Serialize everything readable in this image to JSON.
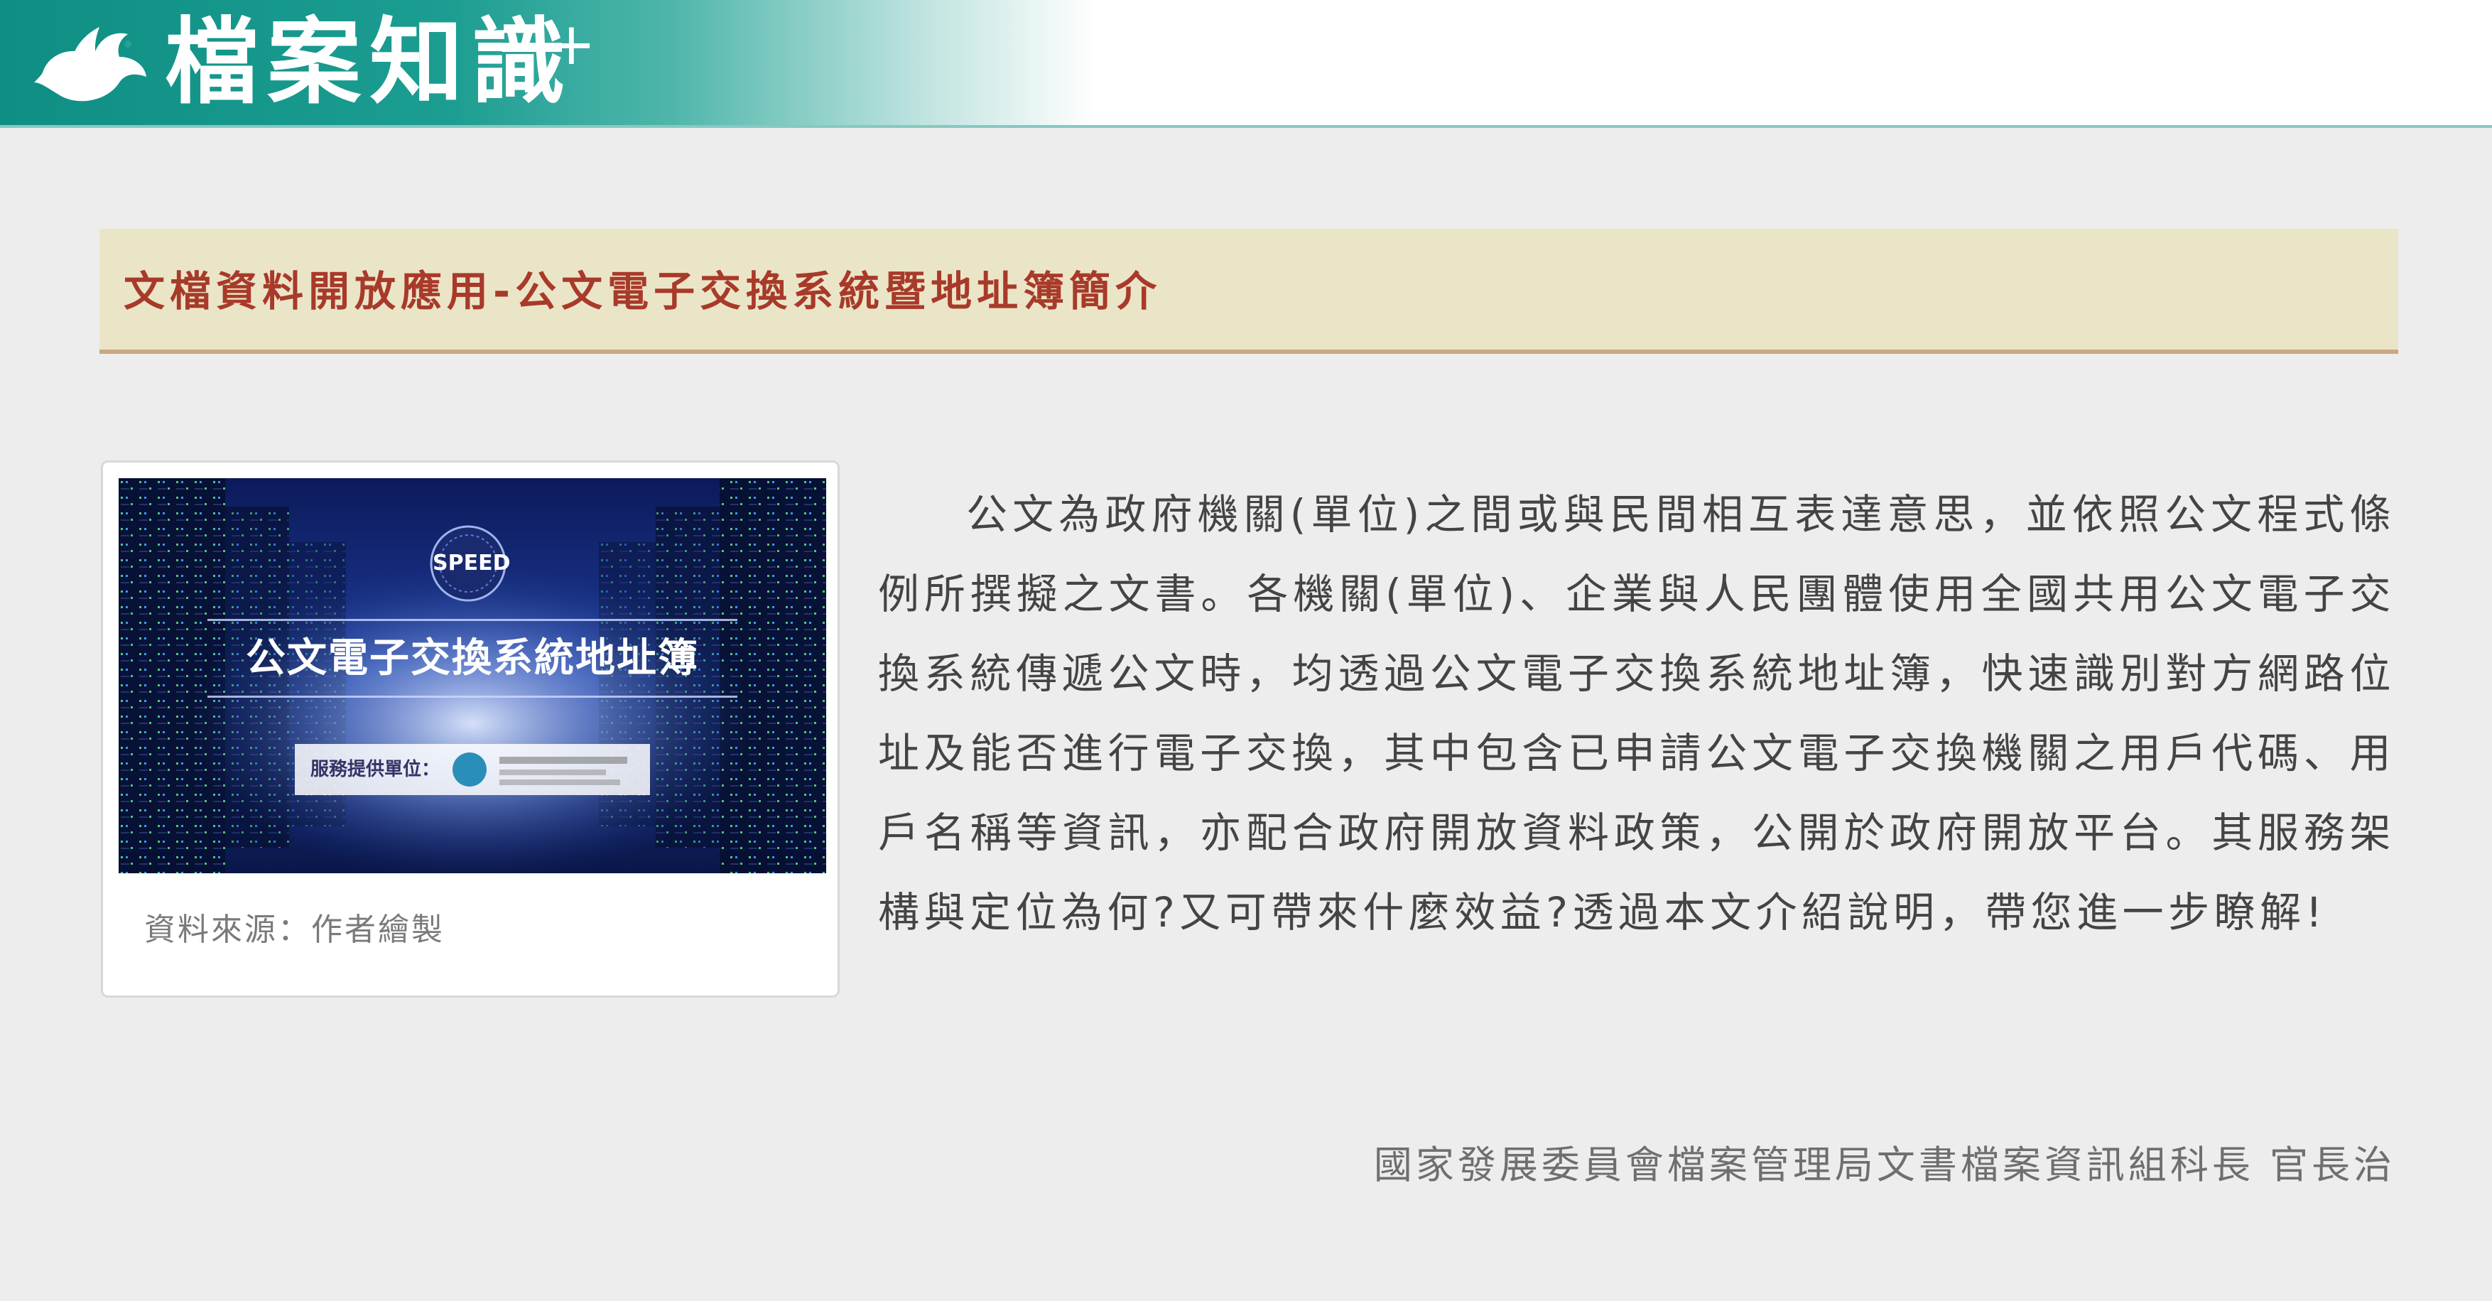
{
  "header": {
    "logo_text": "檔案知識",
    "logo_plus": "+",
    "logo_icon": "bird-icon"
  },
  "article": {
    "title": "文檔資料開放應用-公文電子交換系統暨地址簿簡介",
    "figure": {
      "image_title": "公文電子交換系統地址簿",
      "image_logo": "SPEED",
      "image_provider_label": "服務提供單位：",
      "caption": "資料來源：作者繪製"
    },
    "paragraph": "公文為政府機關(單位)之間或與民間相互表達意思，並依照公文程式條例所撰擬之文書。各機關(單位)、企業與人民團體使用全國共用公文電子交換系統傳遞公文時，均透過公文電子交換系統地址簿，快速識別對方網路位址及能否進行電子交換，其中包含已申請公文電子交換機關之用戶代碼、用戶名稱等資訊，亦配合政府開放資料政策，公開於政府開放平台。其服務架構與定位為何?又可帶來什麼效益?透過本文介紹說明，帶您進一步瞭解!",
    "author": "國家發展委員會檔案管理局文書檔案資訊組科長 官長治"
  },
  "colors": {
    "header_teal": "#0f8f83",
    "title_red": "#a83a2a",
    "banner_bg": "#ebe5c8",
    "page_bg": "#ededed"
  }
}
